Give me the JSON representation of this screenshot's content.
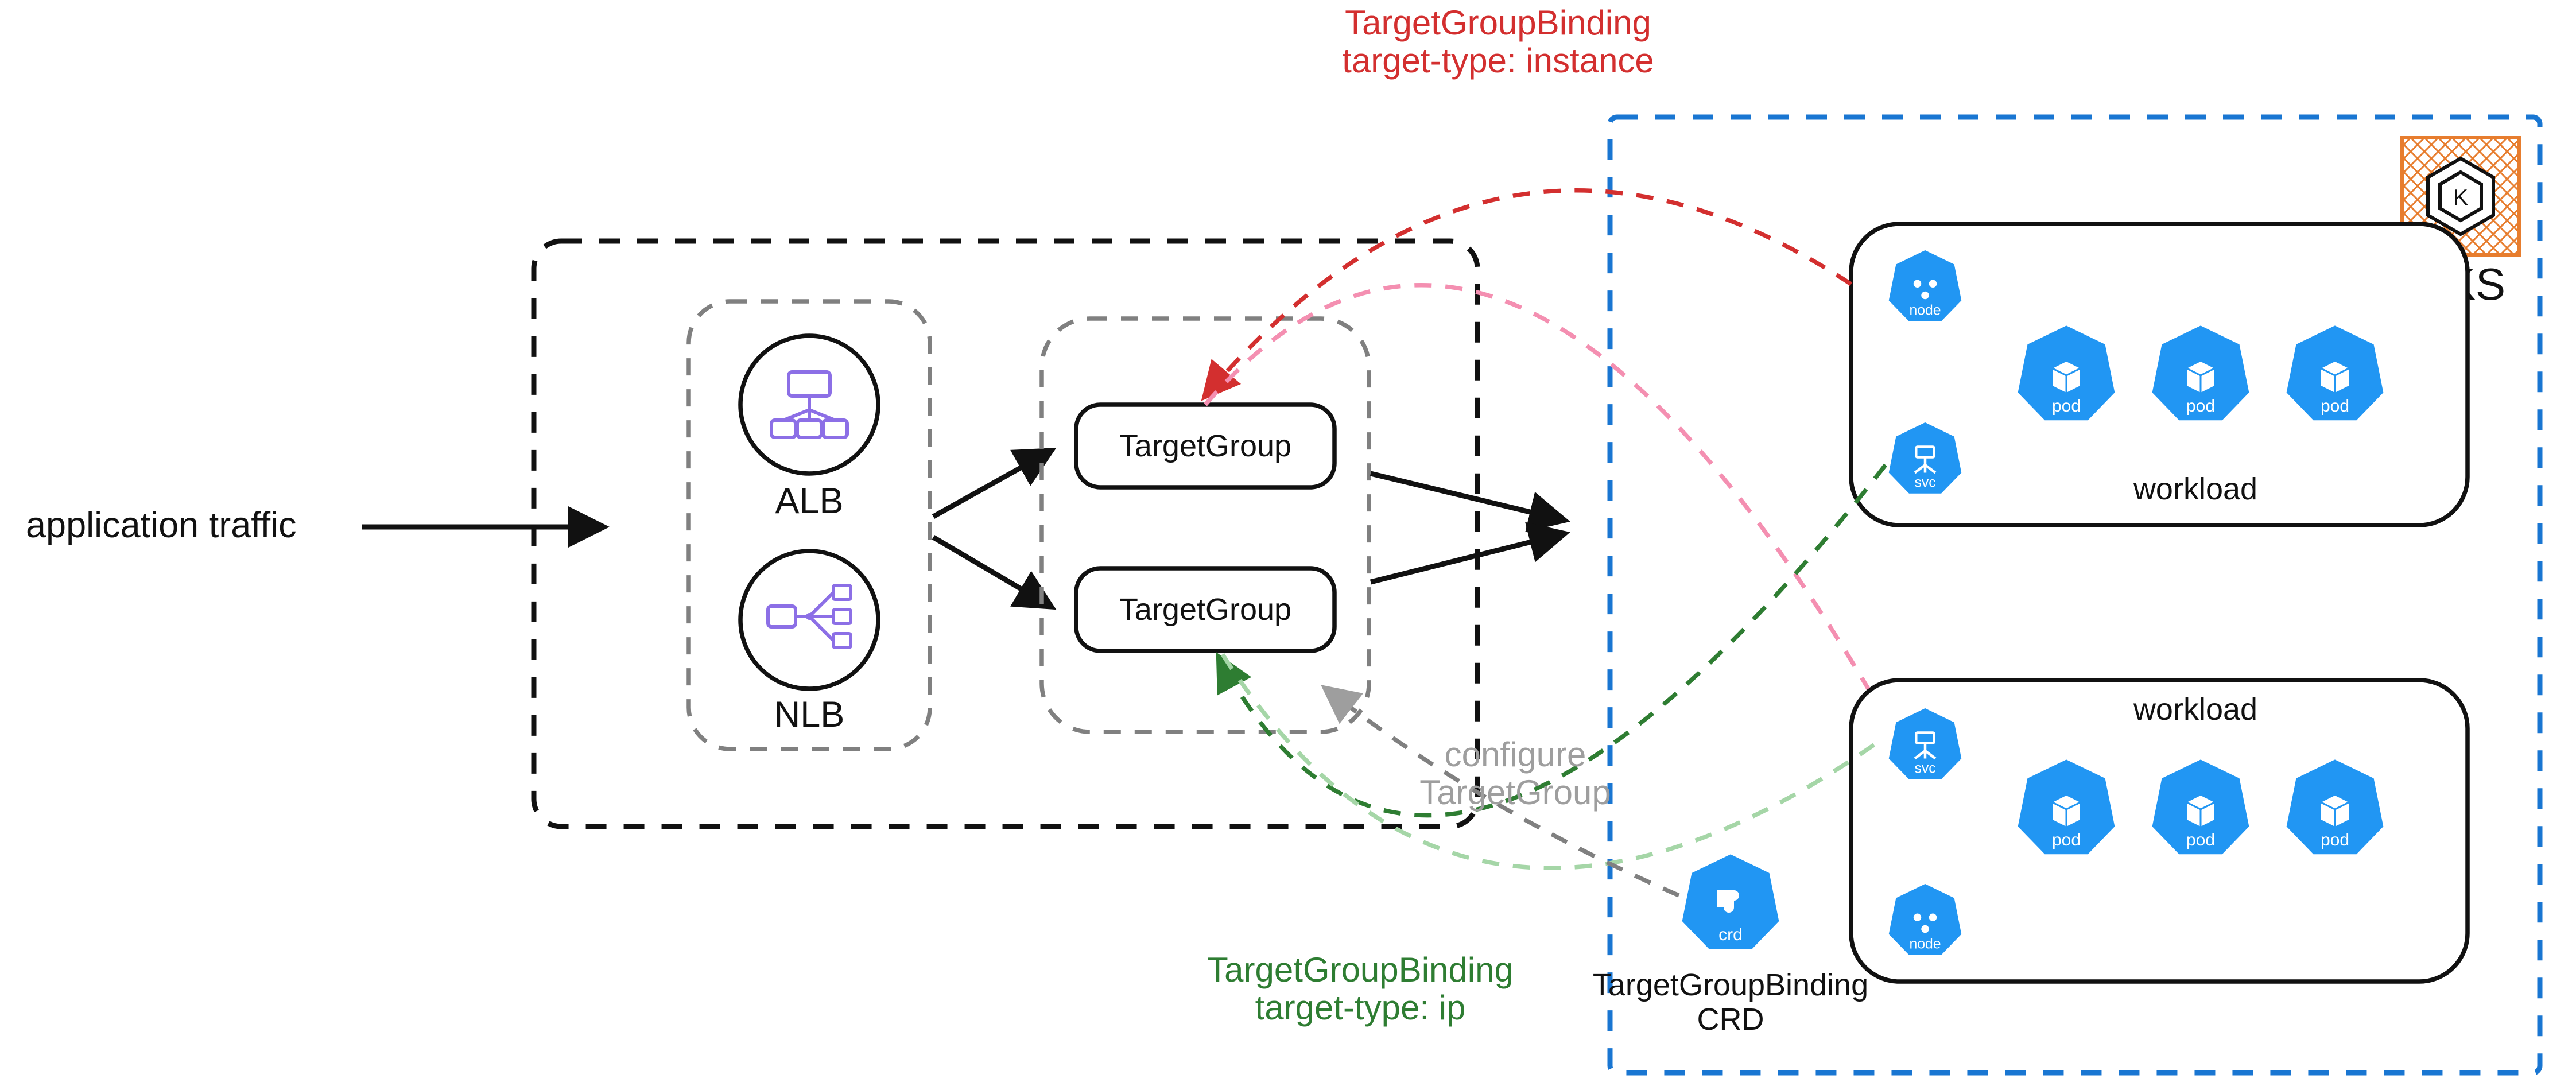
{
  "traffic_label": "application traffic",
  "lb": {
    "alb": "ALB",
    "nlb": "NLB"
  },
  "target_groups": {
    "tg1": "TargetGroup",
    "tg2": "TargetGroup"
  },
  "annotations": {
    "instance": {
      "line1": "TargetGroupBinding",
      "line2": "target-type: instance"
    },
    "ip": {
      "line1": "TargetGroupBinding",
      "line2": "target-type: ip"
    },
    "configure": {
      "line1": "configure",
      "line2": "TargetGroup"
    }
  },
  "eks": {
    "title": "EKS",
    "workload_label": "workload",
    "k8s_labels": {
      "node": "node",
      "svc": "svc",
      "pod": "pod",
      "crd": "crd"
    },
    "crd_caption": {
      "line1": "TargetGroupBinding",
      "line2": "CRD"
    }
  },
  "colors": {
    "black": "#111111",
    "gray": "#808080",
    "red": "#d32f2f",
    "pink": "#f48fb1",
    "green": "#2e7d32",
    "lightgreen": "#a5d6a7",
    "blue": "#1976d2",
    "k8s_blue": "#2196f3",
    "aws_purple": "#8c6fe6",
    "eks_orange": "#e77d2e"
  }
}
